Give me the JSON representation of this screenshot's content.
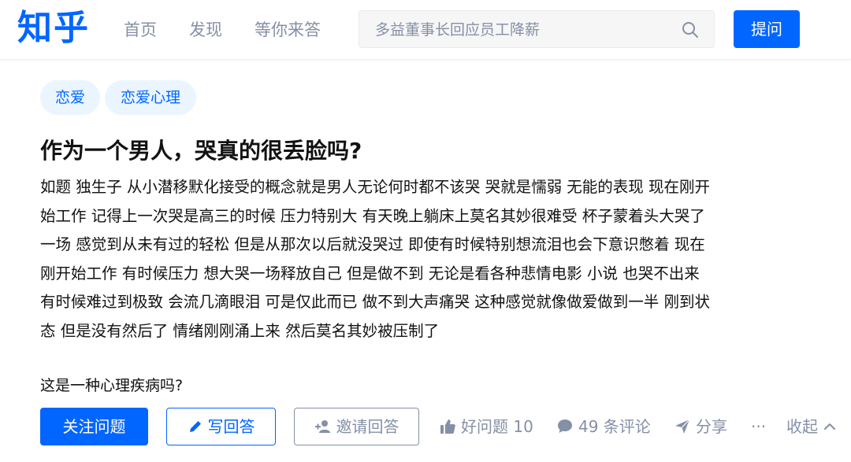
{
  "header": {
    "logo": "知乎",
    "nav": [
      "首页",
      "发现",
      "等你来答"
    ],
    "search_placeholder": "多益董事长回应员工降薪",
    "ask_label": "提问"
  },
  "topics": [
    "恋爱",
    "恋爱心理"
  ],
  "question": {
    "title": "作为一个男人，哭真的很丢脸吗?",
    "description_lines": [
      "如题 独生子 从小潜移默化接受的概念就是男人无论何时都不该哭 哭就是懦弱 无能的表现 现在刚开",
      "始工作 记得上一次哭是高三的时候 压力特别大 有天晚上躺床上莫名其妙很难受 杯子蒙着头大哭了",
      "一场 感觉到从未有过的轻松 但是从那次以后就没哭过 即使有时候特别想流泪也会下意识憋着 现在",
      "刚开始工作 有时候压力 想大哭一场释放自己 但是做不到 无论是看各种悲情电影 小说 也哭不出来",
      "有时候难过到极致 会流几滴眼泪 可是仅此而已 做不到大声痛哭 这种感觉就像做爱做到一半 刚到状",
      "态 但是没有然后了 情绪刚刚涌上来 然后莫名其妙被压制了"
    ],
    "ask_line": "这是一种心理疾病吗?"
  },
  "actions": {
    "follow_label": "关注问题",
    "write_label": "写回答",
    "invite_label": "邀请回答",
    "good_question_label": "好问题 10",
    "comments_label": "49 条评论",
    "share_label": "分享",
    "more_label": "···",
    "collapse_label": "收起"
  },
  "colors": {
    "brand_blue": "#0066ff",
    "muted_gray": "#8590a6",
    "topic_bg": "#ebf5ff"
  }
}
